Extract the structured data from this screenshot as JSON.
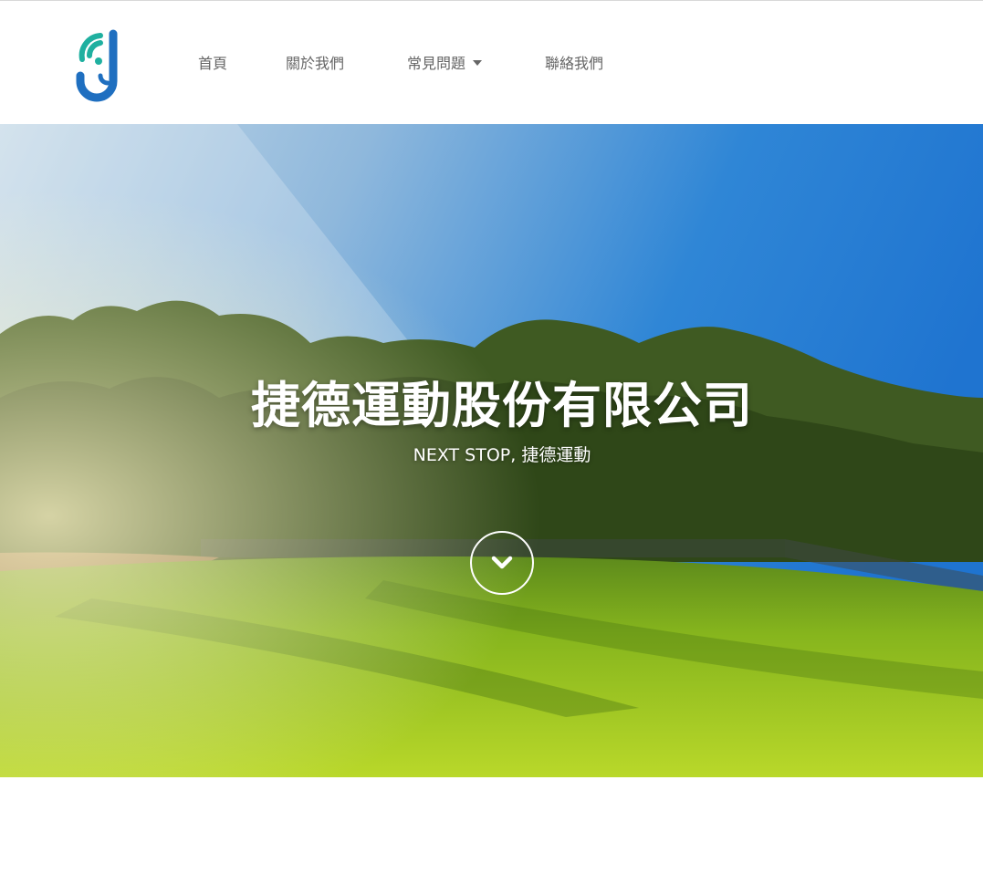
{
  "header": {
    "logo_alt": "J",
    "nav": [
      {
        "label": "首頁"
      },
      {
        "label": "關於我們"
      },
      {
        "label": "常見問題",
        "has_dropdown": true
      },
      {
        "label": "聯絡我們"
      }
    ]
  },
  "hero": {
    "title": "捷德運動股份有限公司",
    "subtitle": "NEXT STOP, 捷德運動",
    "scroll_icon": "chevron-down-icon"
  },
  "colors": {
    "nav_text": "#666666",
    "logo_teal": "#1fb0a0",
    "logo_blue": "#1f6fc0",
    "hero_text": "#ffffff"
  }
}
